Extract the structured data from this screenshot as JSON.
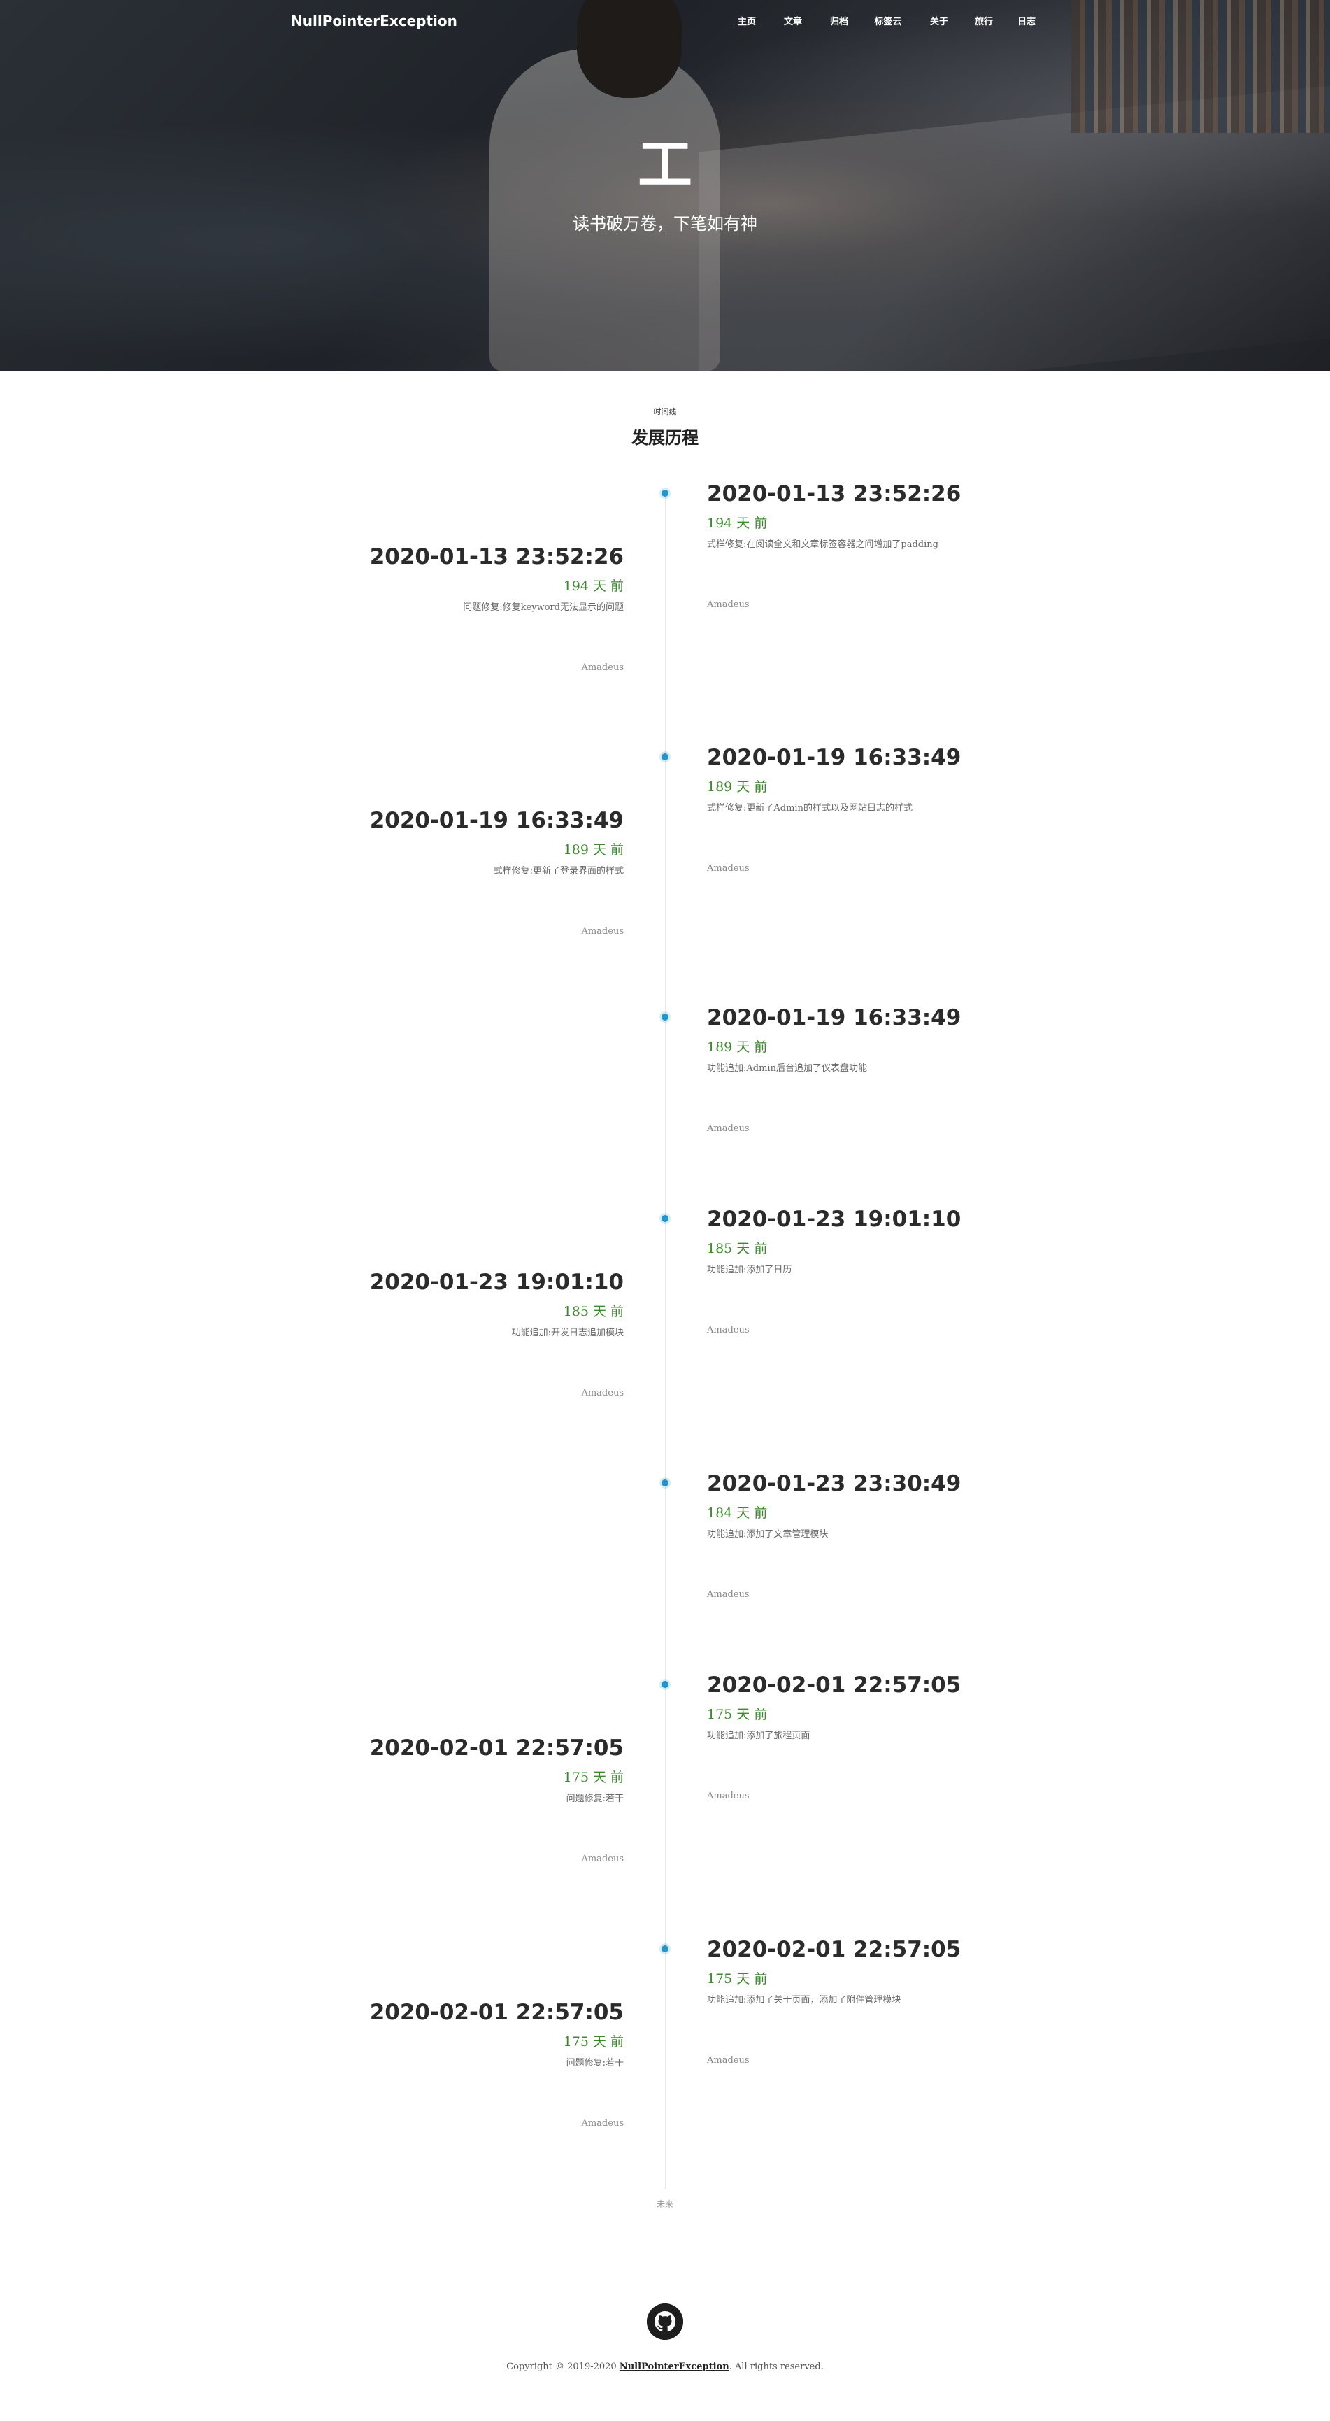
{
  "brand": {
    "name": "NullPointerException"
  },
  "nav": {
    "items": [
      {
        "label": "主页"
      },
      {
        "label": "文章"
      },
      {
        "label": "归档"
      },
      {
        "label": "标签云"
      },
      {
        "label": "关于"
      },
      {
        "label": "旅行"
      },
      {
        "label": "日志"
      }
    ]
  },
  "hero": {
    "mark": "工",
    "tagline": "读书破万卷，下笔如有神"
  },
  "section": {
    "kicker": "时间线",
    "title": "发展历程"
  },
  "timeline": {
    "entries": [
      {
        "date": "2020-01-13 23:52:26",
        "ago": "194 天 前",
        "desc": "式样修复:在阅读全文和文章标签容器之间增加了padding",
        "author": "Amadeus"
      },
      {
        "date": "2020-01-13 23:52:26",
        "ago": "194 天 前",
        "desc": "问题修复:修复keyword无法显示的问题",
        "author": "Amadeus"
      },
      {
        "date": "2020-01-19 16:33:49",
        "ago": "189 天 前",
        "desc": "式样修复:更新了Admin的样式以及网站日志的样式",
        "author": "Amadeus"
      },
      {
        "date": "2020-01-19 16:33:49",
        "ago": "189 天 前",
        "desc": "式样修复:更新了登录界面的样式",
        "author": "Amadeus"
      },
      {
        "date": "2020-01-19 16:33:49",
        "ago": "189 天 前",
        "desc": "功能追加:Admin后台追加了仪表盘功能",
        "author": "Amadeus"
      },
      {
        "date": "2020-01-23 19:01:10",
        "ago": "185 天 前",
        "desc": "功能追加:添加了日历",
        "author": "Amadeus"
      },
      {
        "date": "2020-01-23 19:01:10",
        "ago": "185 天 前",
        "desc": "功能追加:开发日志追加模块",
        "author": "Amadeus"
      },
      {
        "date": "2020-01-23 23:30:49",
        "ago": "184 天 前",
        "desc": "功能追加:添加了文章管理模块",
        "author": "Amadeus"
      },
      {
        "date": "2020-02-01 22:57:05",
        "ago": "175 天 前",
        "desc": "功能追加:添加了旅程页面",
        "author": "Amadeus"
      },
      {
        "date": "2020-02-01 22:57:05",
        "ago": "175 天 前",
        "desc": "问题修复:若干",
        "author": "Amadeus"
      },
      {
        "date": "2020-02-01 22:57:05",
        "ago": "175 天 前",
        "desc": "功能追加:添加了关于页面，添加了附件管理模块",
        "author": "Amadeus"
      },
      {
        "date": "2020-02-01 22:57:05",
        "ago": "175 天 前",
        "desc": "问题修复:若干",
        "author": "Amadeus"
      }
    ],
    "end_label": "未来"
  },
  "footer": {
    "icon": "github-icon",
    "copyright_prefix": "Copyright © 2019-2020 ",
    "copyright_link": "NullPointerException",
    "copyright_suffix": ". All rights reserved."
  },
  "colors": {
    "accent_dot": "#2196c9",
    "ago_green": "#3d8a2e"
  }
}
